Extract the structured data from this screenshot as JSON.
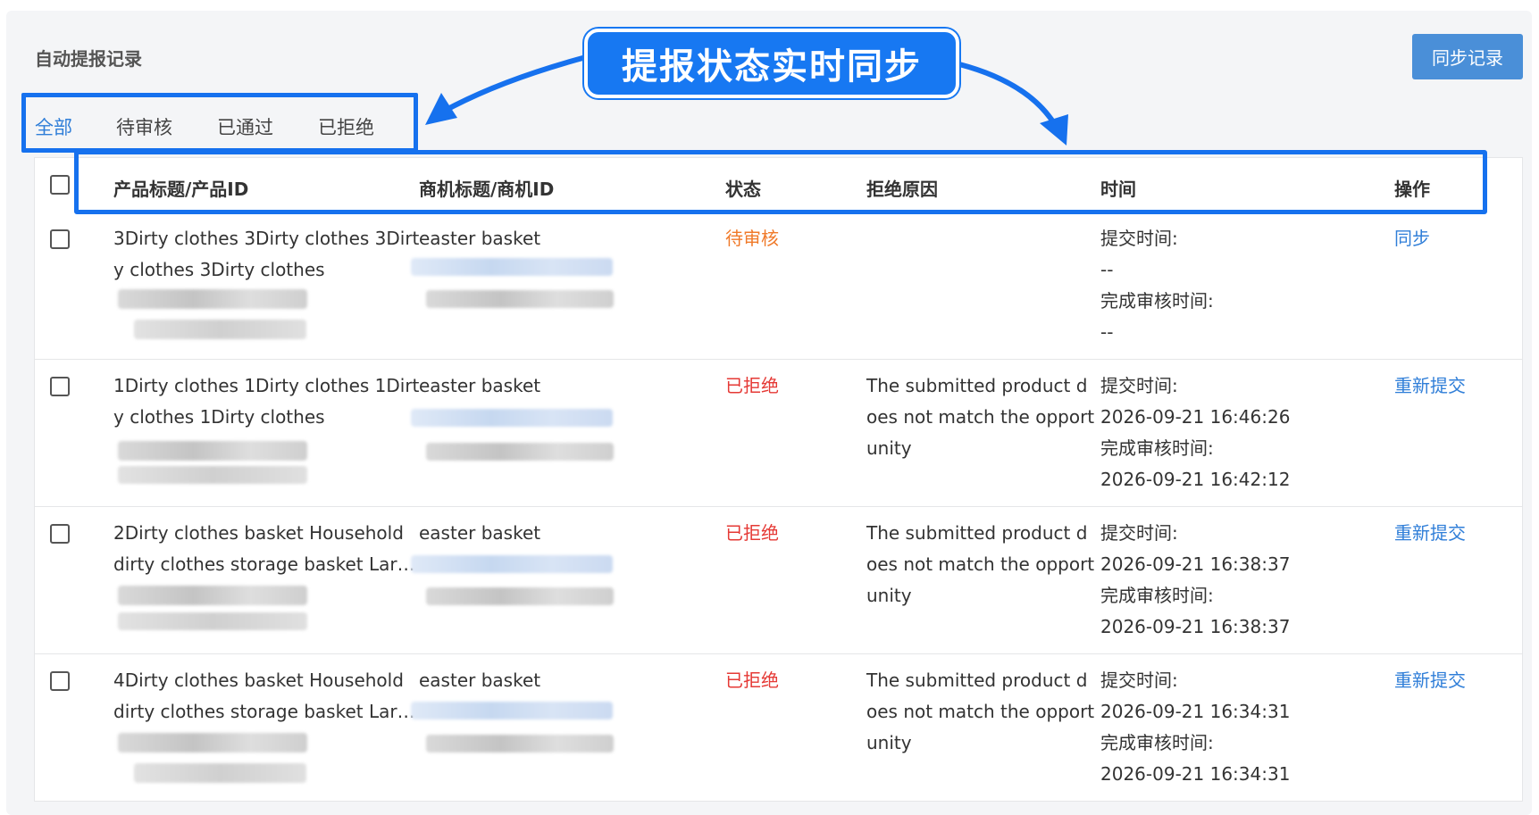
{
  "page": {
    "title": "自动提报记录",
    "sync_button": "同步记录",
    "callout": "提报状态实时同步"
  },
  "tabs": [
    {
      "label": "全部",
      "active": true
    },
    {
      "label": "待审核",
      "active": false
    },
    {
      "label": "已通过",
      "active": false
    },
    {
      "label": "已拒绝",
      "active": false
    }
  ],
  "columns": [
    "产品标题/产品ID",
    "商机标题/商机ID",
    "状态",
    "拒绝原因",
    "时间",
    "操作"
  ],
  "time_labels": {
    "submit": "提交时间:",
    "review": "完成审核时间:"
  },
  "rows": [
    {
      "product_line1": "3Dirty clothes 3Dirty clothes 3Dirt",
      "product_line2": "y clothes 3Dirty clothes",
      "opportunity": "easter basket",
      "status": "待审核",
      "reason_line1": "",
      "reason_line2": "",
      "reason_line3": "",
      "submit_time": "--",
      "review_time": "--",
      "action": "同步"
    },
    {
      "product_line1": "1Dirty clothes 1Dirty clothes 1Dirt",
      "product_line2": "y clothes 1Dirty clothes",
      "opportunity": "easter basket",
      "status": "已拒绝",
      "reason_line1": "The submitted product d",
      "reason_line2": "oes not match the opport",
      "reason_line3": "unity",
      "submit_time": "2026-09-21 16:46:26",
      "review_time": "2026-09-21 16:42:12",
      "action": "重新提交"
    },
    {
      "product_line1": "2Dirty clothes basket Household",
      "product_line2": "dirty clothes storage basket Lar…",
      "opportunity": "easter basket",
      "status": "已拒绝",
      "reason_line1": "The submitted product d",
      "reason_line2": "oes not match the opport",
      "reason_line3": "unity",
      "submit_time": "2026-09-21 16:38:37",
      "review_time": "2026-09-21 16:38:37",
      "action": "重新提交"
    },
    {
      "product_line1": "4Dirty clothes basket Household",
      "product_line2": "dirty clothes storage basket Lar…",
      "opportunity": "easter basket",
      "status": "已拒绝",
      "reason_line1": "The submitted product d",
      "reason_line2": "oes not match the opport",
      "reason_line3": "unity",
      "submit_time": "2026-09-21 16:34:31",
      "review_time": "2026-09-21 16:34:31",
      "action": "重新提交"
    }
  ],
  "colors": {
    "accent": "#2f7ed8",
    "annotation": "#1671ee",
    "pending": "#f07a2a",
    "rejected": "#e53935"
  }
}
